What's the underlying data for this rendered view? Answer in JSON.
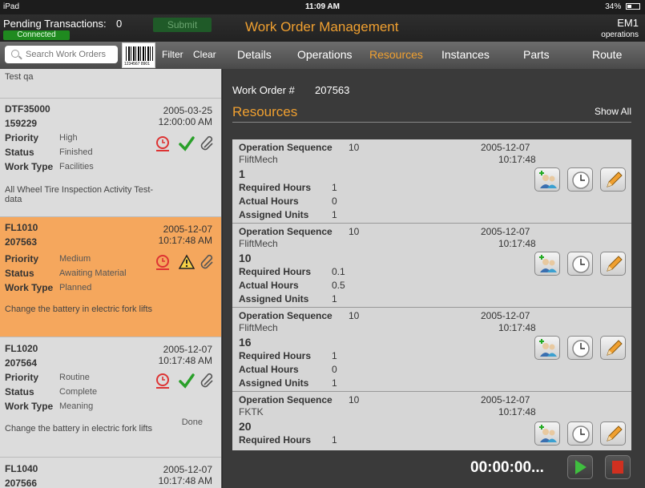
{
  "status_bar": {
    "device": "iPad",
    "time": "11:09 AM",
    "battery": "34%"
  },
  "header": {
    "pending_label": "Pending Transactions:",
    "pending_count": "0",
    "connection_status": "Connected",
    "submit_label": "Submit",
    "title": "Work Order Management",
    "user_code": "EM1",
    "user_role": "operations"
  },
  "toolbar": {
    "search_placeholder": "Search Work Orders",
    "barcode_number": "1234567 8901",
    "filter_label": "Filter",
    "clear_label": "Clear"
  },
  "tabs": [
    {
      "label": "Details",
      "active": false
    },
    {
      "label": "Operations",
      "active": false
    },
    {
      "label": "Resources",
      "active": true
    },
    {
      "label": "Instances",
      "active": false
    },
    {
      "label": "Parts",
      "active": false
    },
    {
      "label": "Route",
      "active": false
    }
  ],
  "work_orders_prev_desc": "Test qa",
  "work_orders": [
    {
      "code": "DTF35000",
      "number": "159229",
      "date": "2005-03-25",
      "time": "12:00:00 AM",
      "priority_label": "Priority",
      "priority": "High",
      "status_label": "Status",
      "status": "Finished",
      "type_label": "Work Type",
      "type": "Facilities",
      "description": "All Wheel Tire Inspection Activity Test-data",
      "status_icon": "check-icon",
      "done": ""
    },
    {
      "code": "FL1010",
      "number": "207563",
      "date": "2005-12-07",
      "time": "10:17:48 AM",
      "priority_label": "Priority",
      "priority": "Medium",
      "status_label": "Status",
      "status": "Awaiting Material",
      "type_label": "Work Type",
      "type": "Planned",
      "description": "Change the battery in electric fork lifts",
      "status_icon": "warning-icon",
      "done": ""
    },
    {
      "code": "FL1020",
      "number": "207564",
      "date": "2005-12-07",
      "time": "10:17:48 AM",
      "priority_label": "Priority",
      "priority": "Routine",
      "status_label": "Status",
      "status": "Complete",
      "type_label": "Work Type",
      "type": "Meaning",
      "description": "Change the battery in electric fork lifts",
      "status_icon": "check-icon",
      "done": "Done"
    },
    {
      "code": "FL1040",
      "number": "207566",
      "date": "2005-12-07",
      "time": "10:17:48 AM"
    }
  ],
  "detail": {
    "wo_label": "Work Order #",
    "wo_number": "207563",
    "section_title": "Resources",
    "show_all_label": "Show All"
  },
  "resources": [
    {
      "op_seq_label": "Operation Sequence",
      "op_seq": "10",
      "date": "2005-12-07",
      "time": "10:17:48",
      "machine": "FliftMech",
      "quantity": "1",
      "req_label": "Required Hours",
      "req": "1",
      "act_label": "Actual Hours",
      "act": "0",
      "units_label": "Assigned Units",
      "units": "1"
    },
    {
      "op_seq_label": "Operation Sequence",
      "op_seq": "10",
      "date": "2005-12-07",
      "time": "10:17:48",
      "machine": "FliftMech",
      "quantity": "10",
      "req_label": "Required Hours",
      "req": "0.1",
      "act_label": "Actual Hours",
      "act": "0.5",
      "units_label": "Assigned Units",
      "units": "1"
    },
    {
      "op_seq_label": "Operation Sequence",
      "op_seq": "10",
      "date": "2005-12-07",
      "time": "10:17:48",
      "machine": "FliftMech",
      "quantity": "16",
      "req_label": "Required Hours",
      "req": "1",
      "act_label": "Actual Hours",
      "act": "0",
      "units_label": "Assigned Units",
      "units": "1"
    },
    {
      "op_seq_label": "Operation Sequence",
      "op_seq": "10",
      "date": "2005-12-07",
      "time": "10:17:48",
      "machine": "FKTK",
      "quantity": "20",
      "req_label": "Required Hours",
      "req": "1"
    }
  ],
  "timer": {
    "value": "00:00:00..."
  },
  "colors": {
    "accent": "#f0a030",
    "selected_row": "#f5a75d",
    "connected": "#1f8a1f",
    "panel_bg": "#3a3a3a",
    "list_bg": "#dcdcdc"
  }
}
